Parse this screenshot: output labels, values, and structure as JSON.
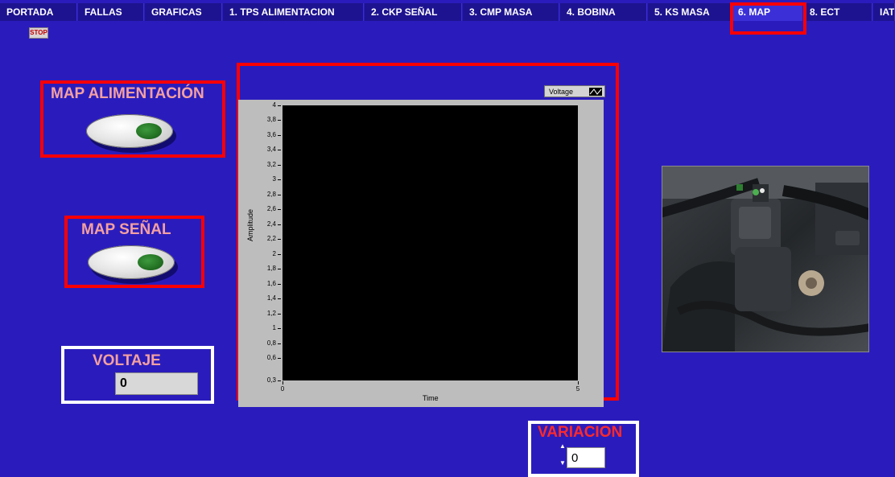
{
  "tabs": [
    {
      "label": "PORTADA",
      "active": false
    },
    {
      "label": "FALLAS",
      "active": false
    },
    {
      "label": "GRAFICAS",
      "active": false
    },
    {
      "label": "1. TPS ALIMENTACION",
      "active": false
    },
    {
      "label": "2. CKP SEÑAL",
      "active": false
    },
    {
      "label": "3. CMP MASA",
      "active": false
    },
    {
      "label": "4. BOBINA",
      "active": false
    },
    {
      "label": "5. KS MASA",
      "active": false
    },
    {
      "label": "6. MAP",
      "active": true
    },
    {
      "label": "8. ECT",
      "active": false
    },
    {
      "label": "IAT",
      "active": false
    }
  ],
  "stop_label": "STOP",
  "controls": {
    "map_alimentacion": {
      "label": "MAP ALIMENTACIÓN"
    },
    "map_senal": {
      "label": "MAP SEÑAL"
    },
    "voltaje": {
      "label": "VOLTAJE",
      "value": "0"
    },
    "variacion": {
      "label": "VARIACION",
      "value": "0"
    }
  },
  "chart_data": {
    "type": "line",
    "legend": "Voltage",
    "xlabel": "Time",
    "ylabel": "Amplitude",
    "xlim": [
      0,
      5
    ],
    "ylim": [
      0.3,
      4
    ],
    "yticks": [
      "4",
      "3,8",
      "3,6",
      "3,4",
      "3,2",
      "3",
      "2,8",
      "2,6",
      "2,4",
      "2,2",
      "2",
      "1,8",
      "1,6",
      "1,4",
      "1,2",
      "1",
      "0,8",
      "0,6",
      "0,3"
    ],
    "xticks": [
      "0",
      "5"
    ],
    "series": [
      {
        "name": "Voltage",
        "values": []
      }
    ]
  },
  "colors": {
    "background": "#2a1cbc",
    "tab": "#1d1390",
    "highlight_red": "#ff0000",
    "label_pink": "#f4a0a0",
    "led_green": "#1f6a1f"
  },
  "photo": {
    "icon": "map-sensor-photo"
  }
}
